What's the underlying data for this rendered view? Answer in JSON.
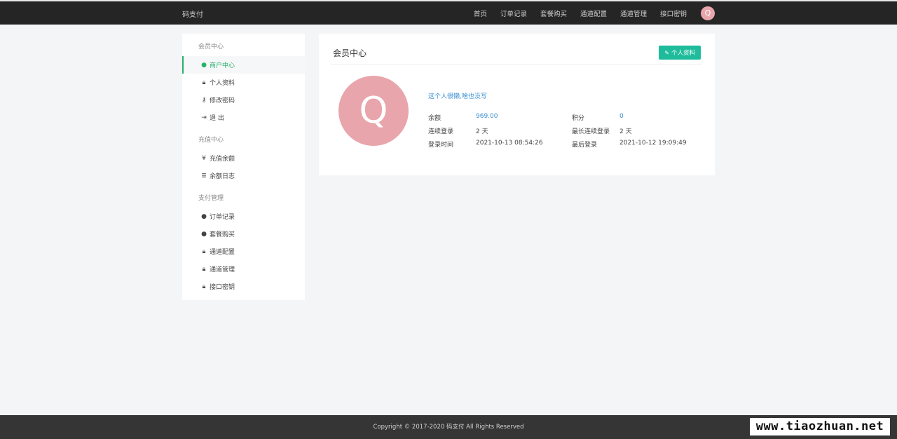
{
  "header": {
    "brand": "码支付",
    "nav": [
      "首页",
      "订单记录",
      "套餐购买",
      "通道配置",
      "通道管理",
      "接口密钥"
    ],
    "avatar_letter": "Q"
  },
  "sidebar": {
    "groups": [
      {
        "title": "会员中心",
        "items": [
          {
            "icon": "user-circle-icon",
            "label": "商户中心",
            "active": true
          },
          {
            "icon": "lock-icon",
            "label": "个人资料"
          },
          {
            "icon": "key-icon",
            "label": "修改密码"
          },
          {
            "icon": "sign-out-icon",
            "label": "退 出"
          }
        ]
      },
      {
        "title": "充值中心",
        "items": [
          {
            "icon": "yen-icon",
            "label": "充值余额"
          },
          {
            "icon": "list-icon",
            "label": "余额日志"
          }
        ]
      },
      {
        "title": "支付管理",
        "items": [
          {
            "icon": "user-circle-icon",
            "label": "订单记录"
          },
          {
            "icon": "user-circle-icon",
            "label": "套餐购买"
          },
          {
            "icon": "lock-icon",
            "label": "通道配置"
          },
          {
            "icon": "lock-icon",
            "label": "通道管理"
          },
          {
            "icon": "lock-icon",
            "label": "接口密钥"
          }
        ]
      }
    ]
  },
  "main": {
    "title": "会员中心",
    "edit_button": "个人资料",
    "avatar_letter": "Q",
    "bio": "这个人很懒,啥也没写",
    "stats": {
      "balance_label": "余额",
      "balance": "969.00",
      "points_label": "积分",
      "points": "0",
      "consecutive_label": "连续登录",
      "consecutive": "2 天",
      "longest_label": "最长连续登录",
      "longest": "2 天",
      "login_time_label": "登录时间",
      "login_time": "2021-10-13 08:54:26",
      "last_login_label": "最后登录",
      "last_login": "2021-10-12 19:09:49"
    }
  },
  "footer": {
    "copyright": "Copyright © 2017-2020 码支付 All Rights Reserved"
  },
  "watermark": "www.tiaozhuan.net",
  "colors": {
    "topbar": "#252525",
    "accent_green": "#25b36b",
    "button_teal": "#1fbc9c",
    "avatar_pink": "#e8a5ab",
    "link_blue": "#3a8fd1",
    "footer": "#353535"
  }
}
